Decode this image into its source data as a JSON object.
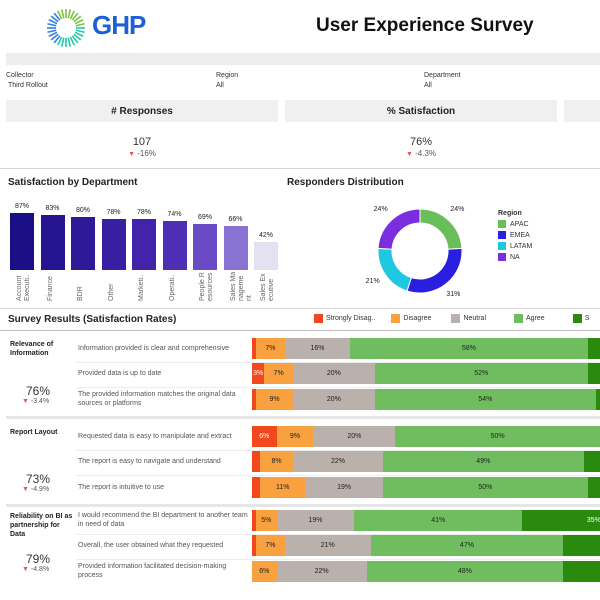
{
  "header": {
    "logo_text": "GHP",
    "title": "User Experience Survey"
  },
  "filters": [
    {
      "label": "Collector",
      "value": "Third Rollout"
    },
    {
      "label": "Region",
      "value": "All"
    },
    {
      "label": "Department",
      "value": "All"
    }
  ],
  "kpis": [
    {
      "title": "# Responses",
      "value": "107",
      "delta": "-16%"
    },
    {
      "title": "% Satisfaction",
      "value": "76%",
      "delta": "-4.3%"
    }
  ],
  "colors": {
    "strongly_disagree": "#f1481e",
    "disagree": "#f9a03f",
    "neutral": "#bab0ac",
    "agree": "#6fbd5e",
    "strongly_agree": "#2a8a0e",
    "apac": "#6abe5a",
    "emea": "#2a1ee0",
    "latam": "#1ec8e0",
    "na": "#7b2ee0",
    "delta_down": "#e15759"
  },
  "satisfaction_by_department": {
    "title": "Satisfaction by Department",
    "chart_data": {
      "type": "bar",
      "categories": [
        "Account Executi..",
        "Finance",
        "BDR",
        "Other",
        "Marketi..",
        "Operati..",
        "People R esources",
        "Sales Ma nageme nt",
        "Sales Ex ecutive"
      ],
      "values": [
        87,
        83,
        80,
        78,
        78,
        74,
        69,
        66,
        42
      ],
      "value_labels": [
        "87%",
        "83%",
        "80%",
        "78%",
        "78%",
        "74%",
        "69%",
        "66%",
        "42%"
      ],
      "ylim": [
        0,
        100
      ],
      "bar_colors": [
        "#1b0f85",
        "#25138f",
        "#2e1998",
        "#381ea1",
        "#4124aa",
        "#4d2eb5",
        "#6a4bc5",
        "#8a72d3",
        "#e4e2f2"
      ]
    }
  },
  "responders_distribution": {
    "title": "Responders Distribution",
    "legend_title": "Region",
    "chart_data": {
      "type": "pie",
      "labels": [
        "APAC",
        "EMEA",
        "LATAM",
        "NA"
      ],
      "values": [
        24,
        31,
        21,
        24
      ],
      "value_labels": [
        "24%",
        "31%",
        "21%",
        "24%"
      ],
      "colors": [
        "#6abe5a",
        "#2a1ee0",
        "#1ec8e0",
        "#7b2ee0"
      ]
    }
  },
  "survey": {
    "title": "Survey Results (Satisfaction Rates)",
    "legend": [
      "Strongly Disag..",
      "Disagree",
      "Neutral",
      "Agree",
      "S"
    ],
    "groups": [
      {
        "label": "Relevance of Information",
        "satisfaction": "76%",
        "delta": "-3.4%",
        "questions": [
          {
            "text": "Information provided is clear and comprehensive",
            "values": [
              1,
              7,
              16,
              58,
              4
            ],
            "labels": [
              "",
              "7%",
              "16%",
              "58%",
              ""
            ]
          },
          {
            "text": "Provided data is up to date",
            "values": [
              3,
              7,
              20,
              52,
              3
            ],
            "labels": [
              "3%",
              "7%",
              "20%",
              "52%",
              ""
            ]
          },
          {
            "text": "The provided information matches the original data sources or platforms",
            "values": [
              1,
              9,
              20,
              54,
              3
            ],
            "labels": [
              "",
              "9%",
              "20%",
              "54%",
              ""
            ]
          }
        ]
      },
      {
        "label": "Report Layout",
        "satisfaction": "73%",
        "delta": "-4.9%",
        "questions": [
          {
            "text": "Requested data is easy to manipulate and extract",
            "values": [
              6,
              9,
              20,
              50,
              2
            ],
            "labels": [
              "6%",
              "9%",
              "20%",
              "50%",
              ""
            ]
          },
          {
            "text": "The report is easy to navigate and understand",
            "values": [
              2,
              8,
              22,
              49,
              5
            ],
            "labels": [
              "",
              "8%",
              "22%",
              "49%",
              ""
            ]
          },
          {
            "text": "The report is intuitive to use",
            "values": [
              2,
              11,
              19,
              50,
              4
            ],
            "labels": [
              "",
              "11%",
              "19%",
              "50%",
              ""
            ]
          }
        ]
      },
      {
        "label": "Reliability on BI as partnership for Data",
        "satisfaction": "79%",
        "delta": "-4.8%",
        "questions": [
          {
            "text": "I would recommend the BI department to another team in need of data",
            "values": [
              1,
              5,
              19,
              41,
              35
            ],
            "labels": [
              "",
              "5%",
              "19%",
              "41%",
              "35%"
            ]
          },
          {
            "text": "Overall, the user obtained what they requested",
            "values": [
              1,
              7,
              21,
              47,
              10
            ],
            "labels": [
              "",
              "7%",
              "21%",
              "47%",
              ""
            ]
          },
          {
            "text": "Provided information facilitated decision-making process",
            "values": [
              0,
              6,
              22,
              48,
              10
            ],
            "labels": [
              "",
              "6%",
              "22%",
              "48%",
              ""
            ]
          }
        ]
      }
    ]
  }
}
